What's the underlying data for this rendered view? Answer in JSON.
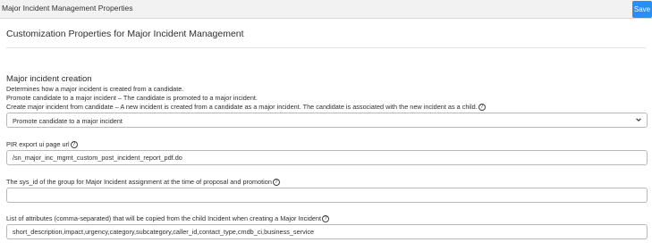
{
  "header": {
    "title": "Major Incident Management Properties",
    "save_label": "Save"
  },
  "page": {
    "heading": "Customization Properties for Major Incident Management"
  },
  "creation": {
    "title": "Major incident creation",
    "line1": "Determines how a major incident is created from a candidate.",
    "line2": "Promote candidate to a major incident – The candidate is promoted to a major incident.",
    "line3": "Create major incident from candidate – A new incident is created from a candidate as a major incident. The candidate is associated with the new incident as a child.",
    "selected": "Promote candidate to a major incident"
  },
  "pir": {
    "label": "PIR export ui page url",
    "value": "/sn_major_inc_mgmt_custom_post_incident_report_pdf.do"
  },
  "group": {
    "label": "The sys_id of the group for Major Incident assignment at the time of proposal and promotion",
    "value": ""
  },
  "attributes": {
    "label": "List of attributes (comma-separated) that will be copied from the child Incident when creating a Major Incident",
    "value": "short_description,impact,urgency,category,subcategory,caller_id,contact_type,cmdb_ci,business_service"
  },
  "icons": {
    "help": "question-circle-icon",
    "dropdown": "chevron-down-icon"
  }
}
